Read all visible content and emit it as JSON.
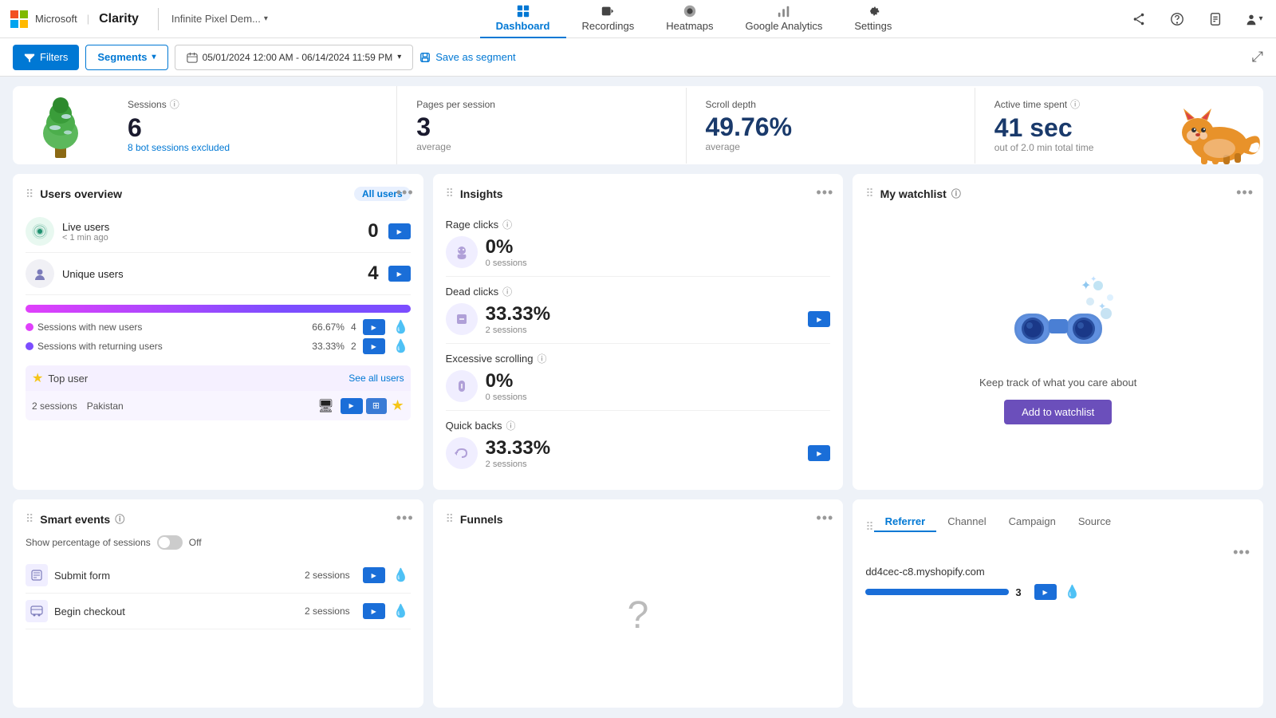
{
  "brand": {
    "microsoft_label": "Microsoft",
    "clarity_label": "Clarity",
    "divider": "|"
  },
  "nav": {
    "project_name": "Infinite Pixel Dem...",
    "tabs": [
      {
        "id": "dashboard",
        "label": "Dashboard",
        "active": true
      },
      {
        "id": "recordings",
        "label": "Recordings",
        "active": false
      },
      {
        "id": "heatmaps",
        "label": "Heatmaps",
        "active": false
      },
      {
        "id": "google_analytics",
        "label": "Google Analytics",
        "active": false
      },
      {
        "id": "settings",
        "label": "Settings",
        "active": false
      }
    ]
  },
  "toolbar": {
    "filters_label": "Filters",
    "segments_label": "Segments",
    "date_range": "05/01/2024 12:00 AM - 06/14/2024 11:59 PM",
    "save_segment_label": "Save as segment"
  },
  "stats": {
    "sessions": {
      "label": "Sessions",
      "value": "6",
      "sub": "8 bot sessions excluded"
    },
    "pages_per_session": {
      "label": "Pages per session",
      "value": "3",
      "sub": "average"
    },
    "scroll_depth": {
      "label": "Scroll depth",
      "value": "49.76%",
      "sub": "average"
    },
    "active_time": {
      "label": "Active time spent",
      "value": "41 sec",
      "sub": "out of 2.0 min total time"
    }
  },
  "users_overview": {
    "title": "Users overview",
    "tab": "All users",
    "menu": "...",
    "live_users": {
      "label": "Live users",
      "value": "0",
      "sub": "< 1 min ago"
    },
    "unique_users": {
      "label": "Unique users",
      "value": "4"
    },
    "sessions_new": {
      "label": "Sessions with new users",
      "pct": "66.67%",
      "count": "4"
    },
    "sessions_returning": {
      "label": "Sessions with returning users",
      "pct": "33.33%",
      "count": "2"
    },
    "top_user_label": "Top user",
    "see_all": "See all users",
    "top_user_sessions": "2 sessions",
    "top_user_country": "Pakistan"
  },
  "insights": {
    "title": "Insights",
    "menu": "...",
    "rage_clicks": {
      "label": "Rage clicks",
      "pct": "0%",
      "sessions": "0 sessions"
    },
    "dead_clicks": {
      "label": "Dead clicks",
      "pct": "33.33%",
      "sessions": "2 sessions"
    },
    "excessive_scrolling": {
      "label": "Excessive scrolling",
      "pct": "0%",
      "sessions": "0 sessions"
    },
    "quick_backs": {
      "label": "Quick backs",
      "pct": "33.33%",
      "sessions": "2 sessions"
    }
  },
  "watchlist": {
    "title": "My watchlist",
    "menu": "...",
    "description": "Keep track of what you care about",
    "add_label": "Add to watchlist"
  },
  "smart_events": {
    "title": "Smart events",
    "menu": "...",
    "toggle_label": "Show percentage of sessions",
    "toggle_state": "Off",
    "events": [
      {
        "name": "Submit form",
        "count": "2 sessions"
      },
      {
        "name": "Begin checkout",
        "count": "2 sessions"
      }
    ]
  },
  "funnels": {
    "title": "Funnels",
    "menu": "..."
  },
  "referrer": {
    "tabs": [
      "Referrer",
      "Channel",
      "Campaign",
      "Source"
    ],
    "active_tab": "Referrer",
    "menu": "...",
    "items": [
      {
        "domain": "dd4cec-c8.myshopify.com",
        "count": "3",
        "bar_width": "180"
      }
    ]
  },
  "icons": {
    "dashboard": "⊞",
    "recordings": "🎥",
    "heatmaps": "☁",
    "google_analytics": "📊",
    "settings": "⚙",
    "live": "📡",
    "user": "👤",
    "filter": "☰",
    "chevron_down": "▾",
    "calendar": "📅",
    "save": "💾",
    "expand": "⤢",
    "info": "ⓘ",
    "more": "•••",
    "drag": "⠿",
    "star": "★",
    "device": "🖥",
    "record_btn": "▶",
    "heatmap_btn": "💧"
  }
}
